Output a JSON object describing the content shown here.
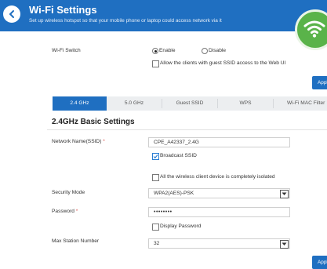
{
  "header": {
    "title": "Wi-Fi Settings",
    "subtitle": "Set up wireless hotspot so that your mobile phone or laptop could access network via it",
    "back_icon": "chevron-left-icon",
    "wifi_icon": "wifi-icon",
    "color": "#1f6fc1"
  },
  "wifi_switch": {
    "label": "Wi-Fi Switch",
    "enable_label": "Enable",
    "disable_label": "Disable",
    "selected": "Enable",
    "guest_access_label": "Allow the clients with guest SSID access to the Web UI",
    "guest_access_checked": false
  },
  "apply_label": "Apply",
  "tabs": [
    {
      "label": "2.4 GHz",
      "active": true
    },
    {
      "label": "5.0 GHz",
      "active": false
    },
    {
      "label": "Guest SSID",
      "active": false
    },
    {
      "label": "WPS",
      "active": false
    },
    {
      "label": "Wi-Fi MAC Filter",
      "active": false
    }
  ],
  "section_title": "2.4GHz Basic Settings",
  "form": {
    "ssid_label": "Network Name(SSID)",
    "required_mark": "*",
    "ssid_value": "CPE_A42337_2.4G",
    "broadcast_label": "Broadcast SSID",
    "broadcast_checked": true,
    "isolation_label": "All the wireless client device is completely isolated",
    "isolation_checked": false,
    "security_label": "Security Mode",
    "security_value": "WPA2(AES)-PSK",
    "password_label": "Password",
    "password_value": "••••••••",
    "display_password_label": "Display Password",
    "display_password_checked": false,
    "max_station_label": "Max Station Number",
    "max_station_value": "32"
  }
}
